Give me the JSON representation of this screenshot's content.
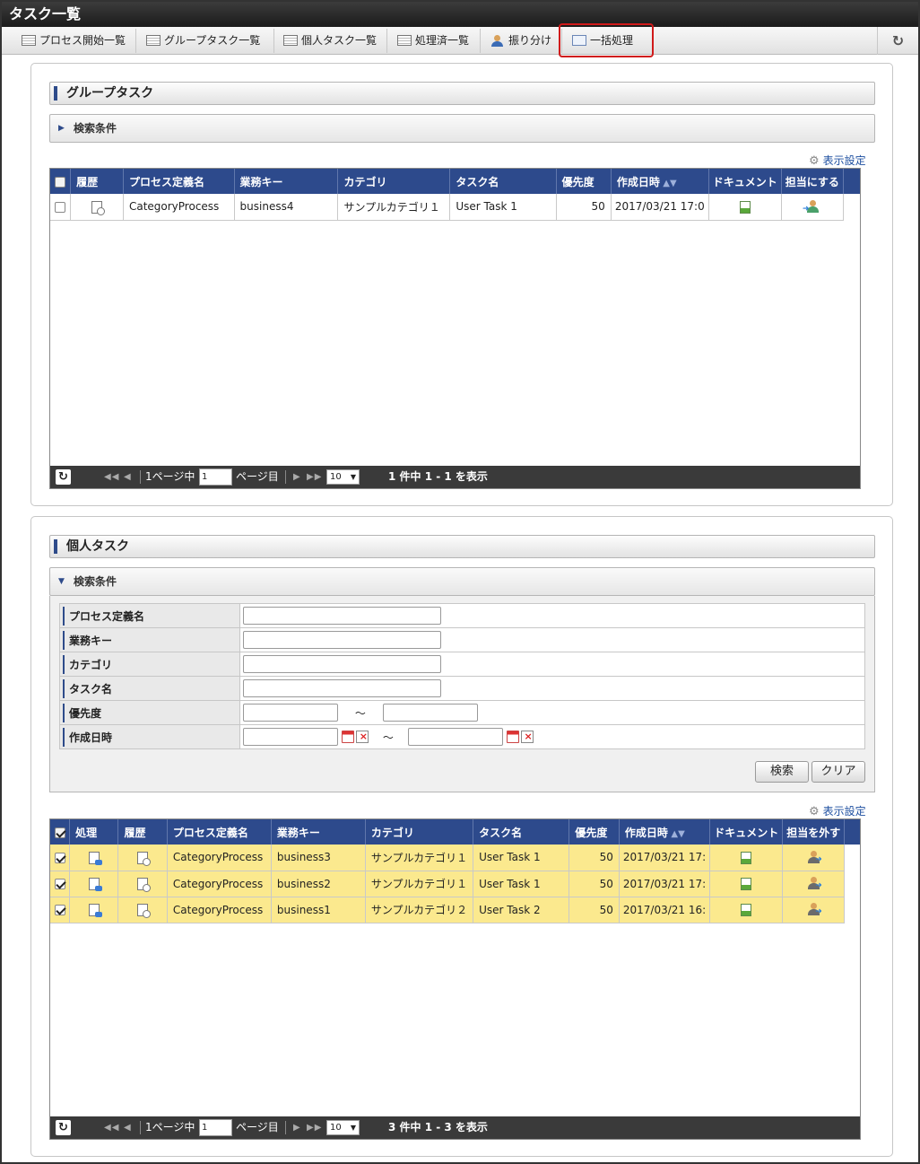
{
  "app": {
    "title": "タスク一覧",
    "refresh_icon": "refresh-icon"
  },
  "tabs": [
    {
      "label": "プロセス開始一覧",
      "icon": "list-icon"
    },
    {
      "label": "グループタスク一覧",
      "icon": "list-icon"
    },
    {
      "label": "個人タスク一覧",
      "icon": "list-icon"
    },
    {
      "label": "処理済一覧",
      "icon": "list-icon"
    },
    {
      "label": "振り分け",
      "icon": "assign-user-icon"
    },
    {
      "label": "一括処理",
      "icon": "batch-icon",
      "highlighted": true
    }
  ],
  "group": {
    "title": "グループタスク",
    "search_label": "検索条件",
    "display_settings": "表示設定",
    "columns": [
      "履歴",
      "プロセス定義名",
      "業務キー",
      "カテゴリ",
      "タスク名",
      "優先度",
      "作成日時",
      "ドキュメント",
      "担当にする"
    ],
    "rows": [
      {
        "process": "CategoryProcess",
        "key": "business4",
        "category": "サンプルカテゴリ１",
        "task": "User Task 1",
        "priority": "50",
        "created": "2017/03/21 17:0"
      }
    ],
    "pager": {
      "page_prefix": "1ページ中",
      "page_value": "1",
      "page_suffix": "ページ目",
      "page_size": "10",
      "summary": "1 件中 1 - 1 を表示"
    }
  },
  "personal": {
    "title": "個人タスク",
    "search_label": "検索条件",
    "form": {
      "process_label": "プロセス定義名",
      "key_label": "業務キー",
      "category_label": "カテゴリ",
      "task_label": "タスク名",
      "priority_label": "優先度",
      "created_label": "作成日時",
      "range_sep": "～"
    },
    "search_button": "検索",
    "clear_button": "クリア",
    "display_settings": "表示設定",
    "columns": [
      "処理",
      "履歴",
      "プロセス定義名",
      "業務キー",
      "カテゴリ",
      "タスク名",
      "優先度",
      "作成日時",
      "ドキュメント",
      "担当を外す"
    ],
    "rows": [
      {
        "process": "CategoryProcess",
        "key": "business3",
        "category": "サンプルカテゴリ１",
        "task": "User Task 1",
        "priority": "50",
        "created": "2017/03/21 17:",
        "checked": true
      },
      {
        "process": "CategoryProcess",
        "key": "business2",
        "category": "サンプルカテゴリ１",
        "task": "User Task 1",
        "priority": "50",
        "created": "2017/03/21 17:",
        "checked": true
      },
      {
        "process": "CategoryProcess",
        "key": "business1",
        "category": "サンプルカテゴリ２",
        "task": "User Task 2",
        "priority": "50",
        "created": "2017/03/21 16:",
        "checked": true
      }
    ],
    "pager": {
      "page_prefix": "1ページ中",
      "page_value": "1",
      "page_suffix": "ページ目",
      "page_size": "10",
      "summary": "3 件中 1 - 3 を表示"
    }
  }
}
